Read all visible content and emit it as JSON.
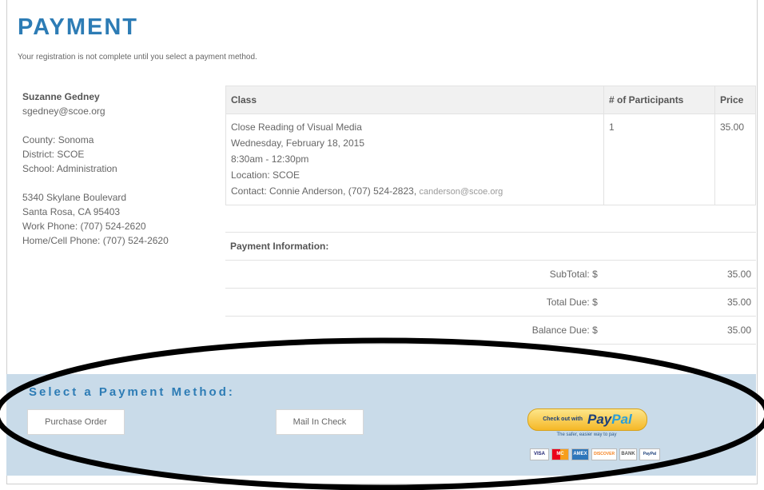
{
  "page": {
    "title": "PAYMENT",
    "notice": "Your registration is not complete until you select a payment method."
  },
  "registrant": {
    "name": "Suzanne Gedney",
    "email": "sgedney@scoe.org",
    "county": "County: Sonoma",
    "district": "District: SCOE",
    "school": "School: Administration",
    "address1": "5340 Skylane Boulevard",
    "address2": "Santa Rosa, CA 95403",
    "work_phone": "Work Phone: (707) 524-2620",
    "home_phone": "Home/Cell Phone: (707) 524-2620"
  },
  "class_table": {
    "headers": [
      "Class",
      "# of Participants",
      "Price"
    ],
    "class_name": "Close Reading of Visual Media",
    "date": "Wednesday, February 18, 2015",
    "time": "8:30am - 12:30pm",
    "location": "Location:  SCOE",
    "contact_prefix": "Contact: Connie Anderson,  (707) 524-2823,",
    "contact_email": "canderson@scoe.org",
    "participants": "1",
    "price": "35.00"
  },
  "payment_info": {
    "heading": "Payment Information:",
    "rows": [
      {
        "label": "SubTotal: $",
        "value": "35.00"
      },
      {
        "label": "Total Due: $",
        "value": "35.00"
      },
      {
        "label": "Balance Due: $",
        "value": "35.00"
      }
    ]
  },
  "payment_method": {
    "heading": "Select a Payment Method:",
    "purchase_order": "Purchase Order",
    "mail_in_check": "Mail In Check",
    "paypal_small": "Check out with",
    "paypal_pay": "Pay",
    "paypal_pal": "Pal",
    "paypal_tagline": "The safer, easier way to pay",
    "cards": [
      "VISA",
      "MC",
      "AMEX",
      "DISCOVER",
      "BANK",
      "PayPal"
    ]
  },
  "colors": {
    "accent": "#2d7cb5",
    "band": "#c9dbe9",
    "annotation": "#000000"
  }
}
